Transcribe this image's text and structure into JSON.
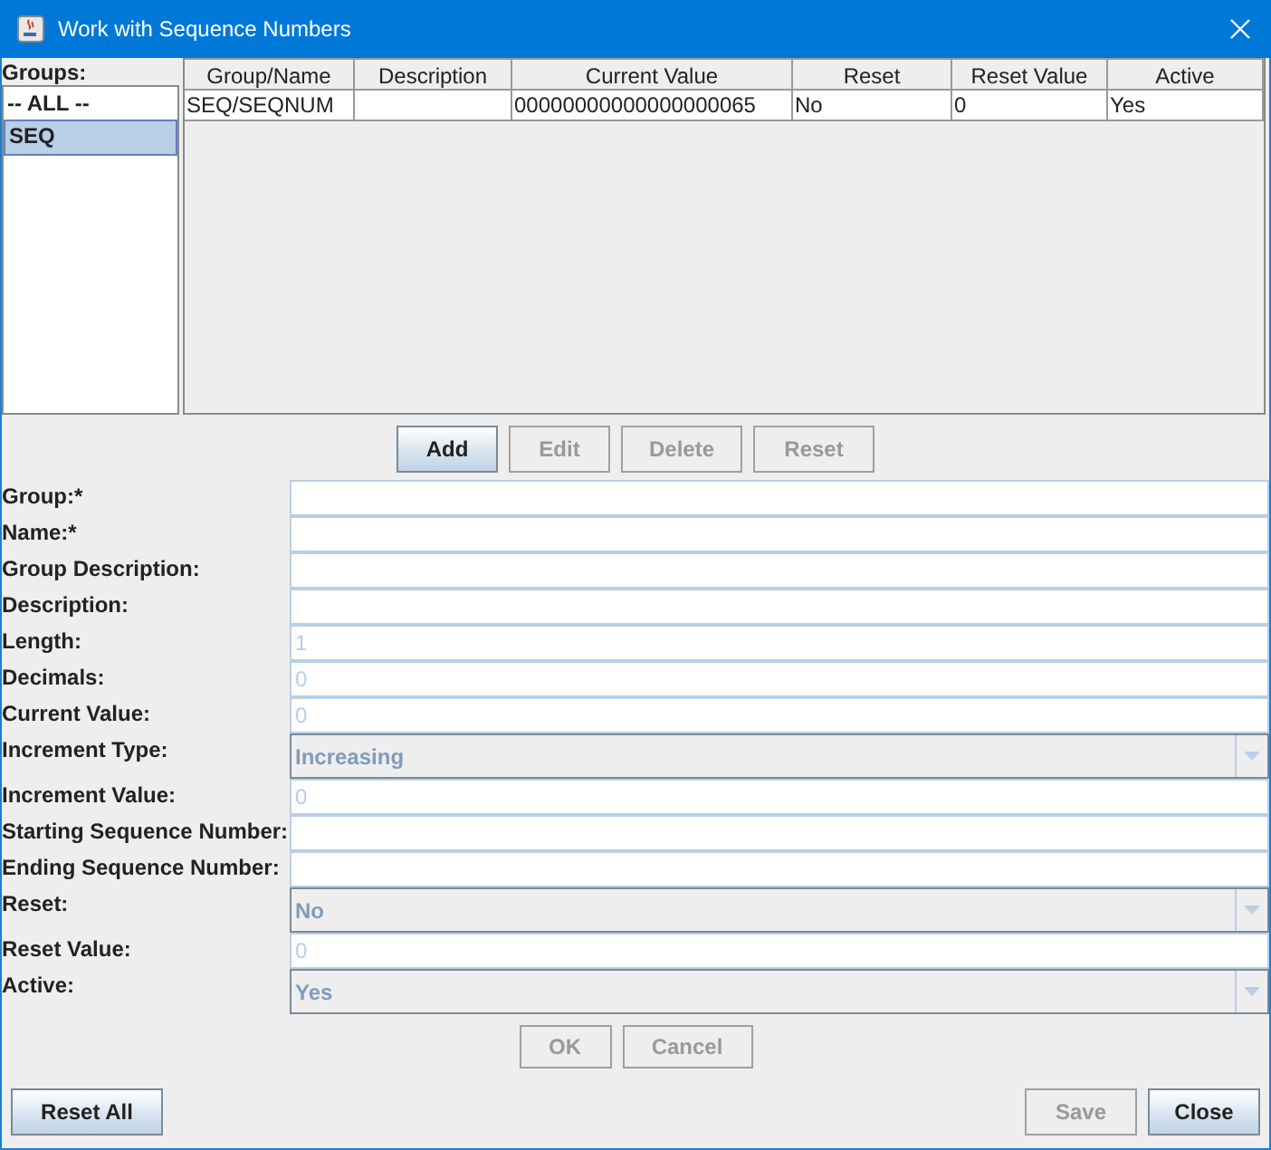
{
  "window": {
    "title": "Work with Sequence Numbers"
  },
  "groups": {
    "label": "Groups:",
    "items": [
      {
        "label": "-- ALL --",
        "selected": false
      },
      {
        "label": "SEQ",
        "selected": true
      }
    ]
  },
  "table": {
    "columns": [
      "Group/Name",
      "Description",
      "Current Value",
      "Reset",
      "Reset Value",
      "Active"
    ],
    "rows": [
      [
        "SEQ/SEQNUM",
        "",
        "00000000000000000065",
        "No",
        "0",
        "Yes"
      ]
    ]
  },
  "table_buttons": [
    {
      "label": "Add",
      "disabled": false
    },
    {
      "label": "Edit",
      "disabled": true
    },
    {
      "label": "Delete",
      "disabled": true
    },
    {
      "label": "Reset",
      "disabled": true
    }
  ],
  "form": [
    {
      "label": "Group:*",
      "kind": "text"
    },
    {
      "label": "Name:*",
      "kind": "text"
    },
    {
      "label": "Group Description:",
      "kind": "text"
    },
    {
      "label": "Description:",
      "kind": "text"
    },
    {
      "label": "Length:",
      "kind": "text",
      "value": "1"
    },
    {
      "label": "Decimals:",
      "kind": "text",
      "value": "0"
    },
    {
      "label": "Current Value:",
      "kind": "text",
      "value": "0"
    },
    {
      "label": "Increment Type:",
      "kind": "combo",
      "value": "Increasing"
    },
    {
      "label": "Increment Value:",
      "kind": "text",
      "value": "0"
    },
    {
      "label": "Starting Sequence Number:",
      "kind": "text"
    },
    {
      "label": "Ending Sequence Number:",
      "kind": "text"
    },
    {
      "label": "Reset:",
      "kind": "combo",
      "value": "No"
    },
    {
      "label": "Reset Value:",
      "kind": "text",
      "value": "0"
    },
    {
      "label": "Active:",
      "kind": "combo",
      "value": "Yes"
    }
  ],
  "form_buttons": [
    {
      "label": "OK",
      "disabled": true
    },
    {
      "label": "Cancel",
      "disabled": true
    }
  ],
  "footer": {
    "left": [
      {
        "label": "Reset All",
        "disabled": false
      }
    ],
    "right": [
      {
        "label": "Save",
        "disabled": true
      },
      {
        "label": "Close",
        "disabled": false
      }
    ]
  }
}
